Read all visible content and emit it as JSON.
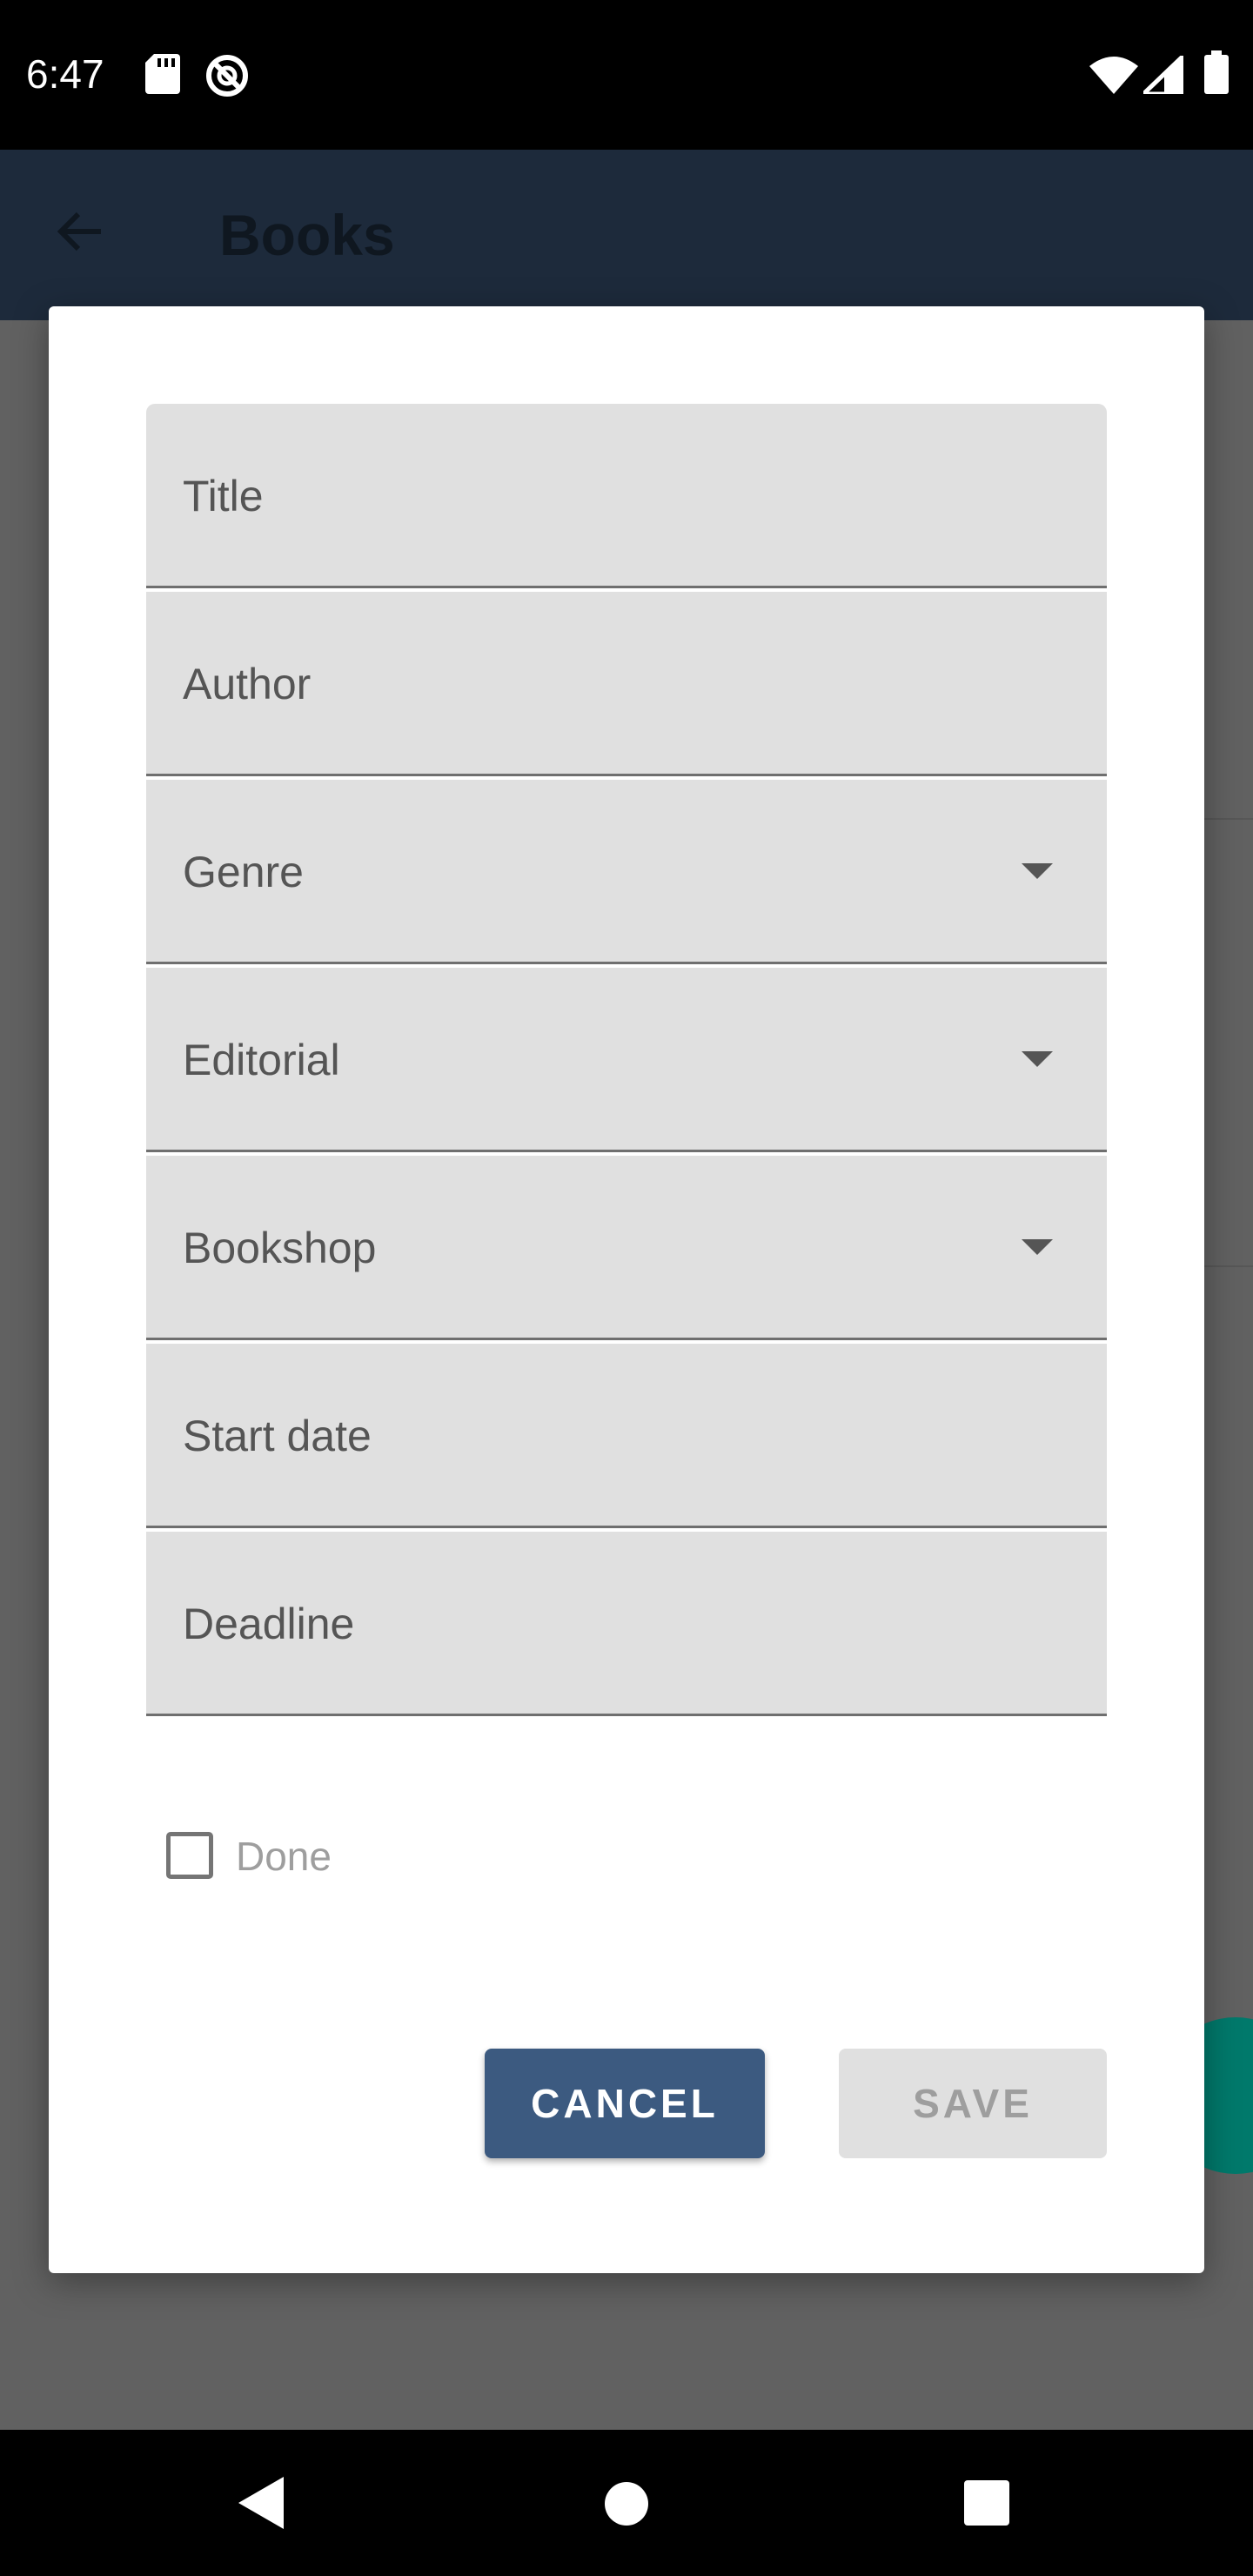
{
  "status_bar": {
    "time": "6:47",
    "left_icons": [
      "sd-card-icon",
      "do-not-disturb-icon"
    ],
    "right_icons": [
      "wifi-icon",
      "cell-signal-icon",
      "battery-icon"
    ]
  },
  "app_bar": {
    "title": "Books",
    "back_icon": "arrow-back-icon"
  },
  "dialog": {
    "fields": [
      {
        "label": "Title",
        "type": "text"
      },
      {
        "label": "Author",
        "type": "text"
      },
      {
        "label": "Genre",
        "type": "dropdown"
      },
      {
        "label": "Editorial",
        "type": "dropdown"
      },
      {
        "label": "Bookshop",
        "type": "dropdown"
      },
      {
        "label": "Start date",
        "type": "date"
      },
      {
        "label": "Deadline",
        "type": "date"
      }
    ],
    "done_checkbox": {
      "label": "Done",
      "checked": false
    },
    "cancel_label": "CANCEL",
    "save_label": "SAVE"
  },
  "colors": {
    "status_bar": "#000000",
    "app_bar": "#1d2a3b",
    "cancel_button": "#3c5a80",
    "save_button_disabled": "#e0e0e0",
    "field_fill": "#e0e0e0",
    "fab": "#00796b"
  },
  "nav_bar": {
    "icons": [
      "nav-back-icon",
      "nav-home-icon",
      "nav-recents-icon"
    ]
  }
}
